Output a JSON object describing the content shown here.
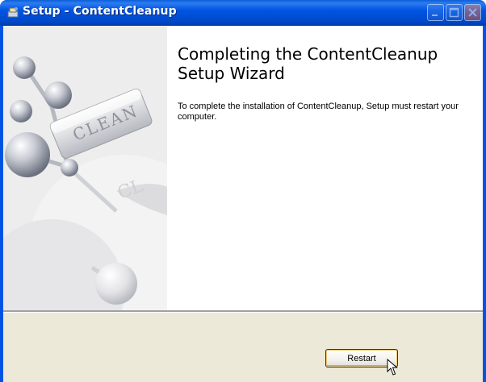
{
  "window": {
    "title": "Setup - ContentCleanup",
    "icon": "setup-icon"
  },
  "side_art": {
    "label": "CLEAN"
  },
  "content": {
    "heading": "Completing the ContentCleanup Setup Wizard",
    "body": "To complete the installation of ContentCleanup, Setup must restart your computer."
  },
  "footer": {
    "restart_label": "Restart"
  },
  "colors": {
    "titlebar": "#0054e3",
    "footer": "#ece9d8",
    "button_border": "#003c74"
  }
}
